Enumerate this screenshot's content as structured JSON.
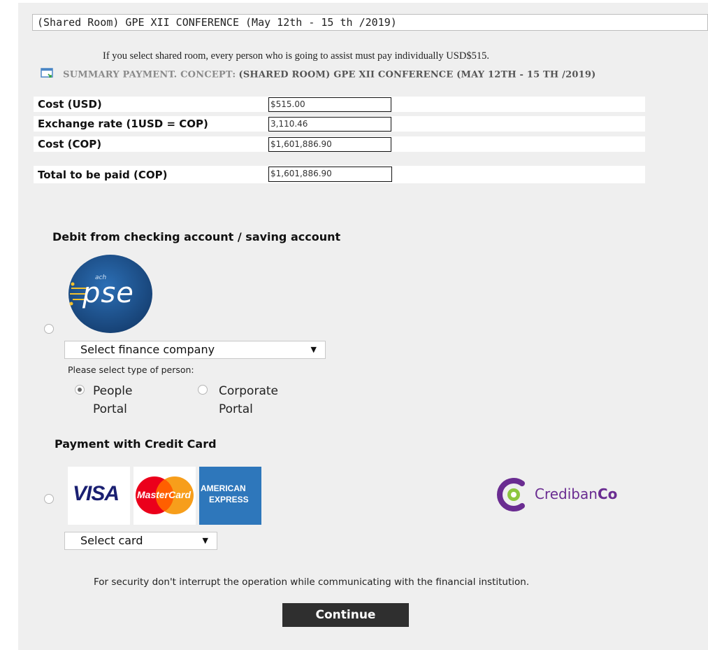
{
  "concept_select": {
    "value": "(Shared Room) GPE XII CONFERENCE (May 12th - 15 th /2019)"
  },
  "notice": "If you select shared room, every person who is going to assist must pay individually USD$515.",
  "summary": {
    "label": "SUMMARY PAYMENT. CONCEPT:",
    "value": "(SHARED ROOM) GPE XII CONFERENCE (MAY 12TH - 15 TH /2019)",
    "icon": "summary-icon"
  },
  "costs": {
    "cost_usd": {
      "label": "Cost  (USD)",
      "value": "$515.00"
    },
    "exchange_rate": {
      "label": "Exchange rate (1USD = COP)",
      "value": "3,110.46"
    },
    "cost_cop": {
      "label": "Cost (COP)",
      "value": "$1,601,886.90"
    },
    "total": {
      "label": "Total to be paid (COP)",
      "value": "$1,601,886.90"
    }
  },
  "debit": {
    "title": "Debit from checking account / saving account",
    "logo": {
      "top_text": "ach",
      "text": "pse"
    },
    "finance_select": "Select finance company",
    "person_prompt": "Please select type of person:",
    "options": [
      {
        "label": "People Portal",
        "selected": true
      },
      {
        "label": "Corporate Portal",
        "selected": false
      }
    ]
  },
  "credit": {
    "title": "Payment with Credit Card",
    "cards": {
      "visa": "VISA",
      "mastercard": "MasterCard",
      "amex_line1": "AMERICAN",
      "amex_line2": "EXPRESS"
    },
    "card_select": "Select card",
    "processor": {
      "part1": "Crediban",
      "part2": "Co"
    }
  },
  "security_note": "For security don't interrupt the operation while communicating with the financial institution.",
  "continue_label": "Continue",
  "colors": {
    "panel_bg": "#efefef",
    "button_bg": "#2f2f2f",
    "pse_blue": "#1b4f8c",
    "visa_blue": "#1a1f71",
    "credibanco_purple": "#6a2c91",
    "credibanco_green": "#8cc63f",
    "amex_blue": "#2e77bb"
  }
}
